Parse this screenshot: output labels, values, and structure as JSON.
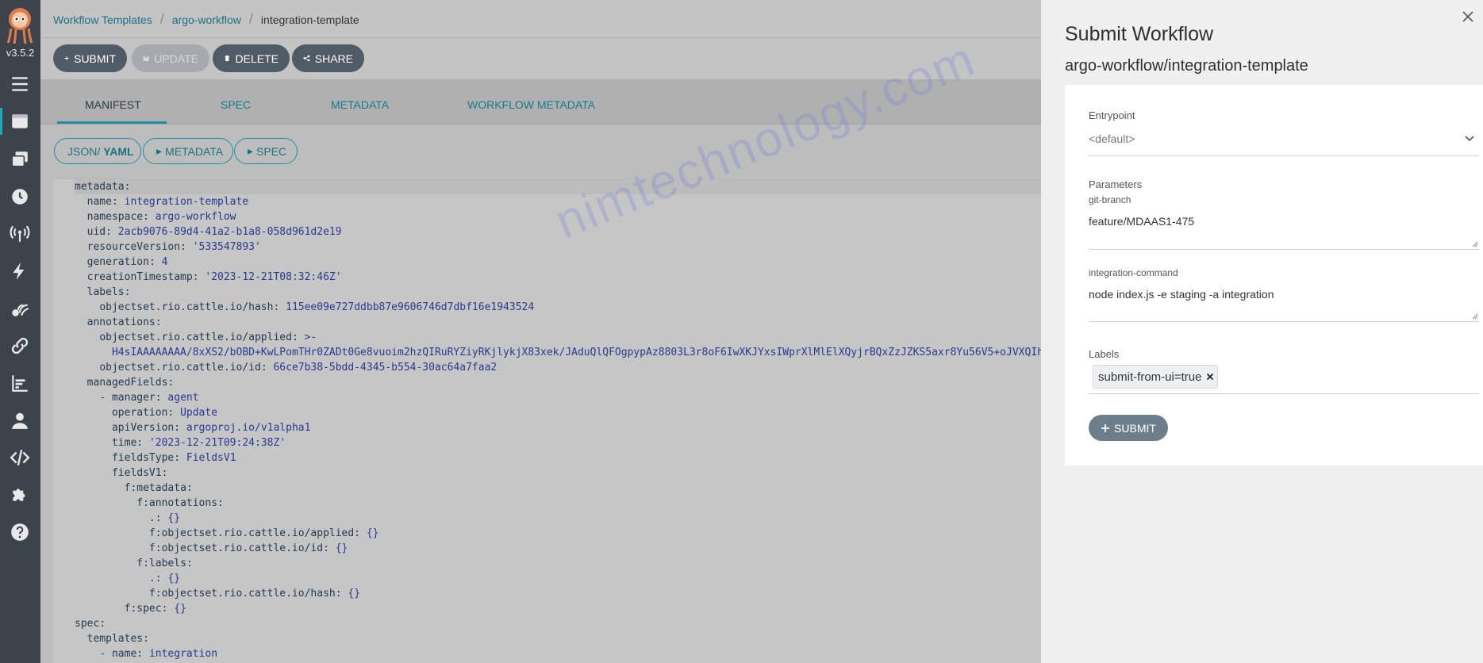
{
  "app": {
    "version": "v3.5.2"
  },
  "breadcrumb": {
    "items": [
      "Workflow Templates",
      "argo-workflow",
      "integration-template"
    ]
  },
  "toolbar": {
    "submit_label": "SUBMIT",
    "update_label": "UPDATE",
    "delete_label": "DELETE",
    "share_label": "SHARE"
  },
  "tabs": [
    {
      "label": "MANIFEST",
      "active": true
    },
    {
      "label": "SPEC",
      "active": false
    },
    {
      "label": "METADATA",
      "active": false
    },
    {
      "label": "WORKFLOW METADATA",
      "active": false
    }
  ],
  "view_toggles": {
    "json_label": "JSON/",
    "yaml_label": "YAML",
    "metadata_label": "METADATA",
    "spec_label": "SPEC"
  },
  "manifest": {
    "lines": [
      {
        "indent": 0,
        "key": "metadata",
        "sep": ":",
        "value": ""
      },
      {
        "indent": 1,
        "key": "name",
        "sep": ": ",
        "value": "integration-template"
      },
      {
        "indent": 1,
        "key": "namespace",
        "sep": ": ",
        "value": "argo-workflow"
      },
      {
        "indent": 1,
        "key": "uid",
        "sep": ": ",
        "value": "2acb9076-89d4-41a2-b1a8-058d961d2e19"
      },
      {
        "indent": 1,
        "key": "resourceVersion",
        "sep": ": ",
        "value": "'533547893'"
      },
      {
        "indent": 1,
        "key": "generation",
        "sep": ": ",
        "value": "4"
      },
      {
        "indent": 1,
        "key": "creationTimestamp",
        "sep": ": ",
        "value": "'2023-12-21T08:32:46Z'"
      },
      {
        "indent": 1,
        "key": "labels",
        "sep": ":",
        "value": ""
      },
      {
        "indent": 2,
        "key": "objectset.rio.cattle.io/hash",
        "sep": ": ",
        "value": "115ee09e727ddbb87e9606746d7dbf16e1943524"
      },
      {
        "indent": 1,
        "key": "annotations",
        "sep": ":",
        "value": ""
      },
      {
        "indent": 2,
        "key": "objectset.rio.cattle.io/applied",
        "sep": ": ",
        "value": ">-"
      },
      {
        "indent": 3,
        "key": "",
        "sep": "",
        "value": "H4sIAAAAAAAA/8xXS2/bOBD+KwLPomTHr0ZADt0Ge8vuoim2hzQIRuRYZiyRKjlykjX83xek/JAduQlQFOgpypAz8803L3r8oF6IwXKJYxsIWprXlMlElXQyjrBQxZzJZKS5axr8Yu56V5+oJVXQIh"
      },
      {
        "indent": 2,
        "key": "objectset.rio.cattle.io/id",
        "sep": ": ",
        "value": "66ce7b38-5bdd-4345-b554-30ac64a7faa2"
      },
      {
        "indent": 1,
        "key": "managedFields",
        "sep": ":",
        "value": ""
      },
      {
        "indent": 2,
        "key": "- manager",
        "sep": ": ",
        "value": "agent"
      },
      {
        "indent": 3,
        "key": "operation",
        "sep": ": ",
        "value": "Update"
      },
      {
        "indent": 3,
        "key": "apiVersion",
        "sep": ": ",
        "value": "argoproj.io/v1alpha1"
      },
      {
        "indent": 3,
        "key": "time",
        "sep": ": ",
        "value": "'2023-12-21T09:24:38Z'"
      },
      {
        "indent": 3,
        "key": "fieldsType",
        "sep": ": ",
        "value": "FieldsV1"
      },
      {
        "indent": 3,
        "key": "fieldsV1",
        "sep": ":",
        "value": ""
      },
      {
        "indent": 4,
        "key": "f:metadata",
        "sep": ":",
        "value": ""
      },
      {
        "indent": 5,
        "key": "f:annotations",
        "sep": ":",
        "value": ""
      },
      {
        "indent": 6,
        "key": ".",
        "sep": ": ",
        "value": "{}"
      },
      {
        "indent": 6,
        "key": "f:objectset.rio.cattle.io/applied",
        "sep": ": ",
        "value": "{}"
      },
      {
        "indent": 6,
        "key": "f:objectset.rio.cattle.io/id",
        "sep": ": ",
        "value": "{}"
      },
      {
        "indent": 5,
        "key": "f:labels",
        "sep": ":",
        "value": ""
      },
      {
        "indent": 6,
        "key": ".",
        "sep": ": ",
        "value": "{}"
      },
      {
        "indent": 6,
        "key": "f:objectset.rio.cattle.io/hash",
        "sep": ": ",
        "value": "{}"
      },
      {
        "indent": 4,
        "key": "f:spec",
        "sep": ": ",
        "value": "{}"
      },
      {
        "indent": 0,
        "key": "spec",
        "sep": ":",
        "value": ""
      },
      {
        "indent": 1,
        "key": "templates",
        "sep": ":",
        "value": ""
      },
      {
        "indent": 2,
        "key": "- name",
        "sep": ": ",
        "value": "integration"
      }
    ]
  },
  "watermark": "nimtechnology.com",
  "submit_panel": {
    "title": "Submit Workflow",
    "subtitle": "argo-workflow/integration-template",
    "entrypoint_label": "Entrypoint",
    "entrypoint_value": "<default>",
    "parameters_label": "Parameters",
    "params": [
      {
        "name": "git-branch",
        "value": "feature/MDAAS1-475"
      },
      {
        "name": "integration-command",
        "value": "node index.js -e staging -a integration"
      }
    ],
    "labels_label": "Labels",
    "label_chip": "submit-from-ui=true",
    "submit_label": "SUBMIT"
  },
  "colors": {
    "accent": "#1f8fa3",
    "nav_bg": "#3c434a",
    "button_dark": "#4f5b65",
    "submit_button": "#6e7d8a"
  }
}
